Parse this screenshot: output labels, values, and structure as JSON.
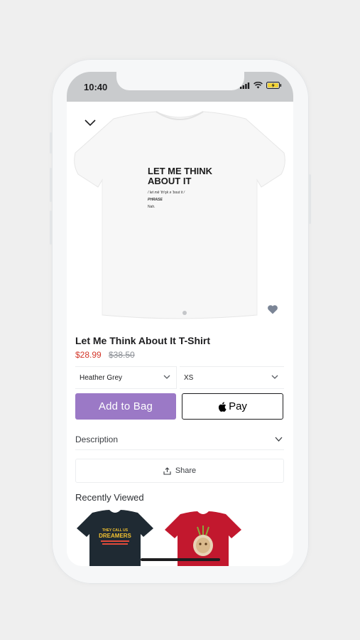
{
  "status": {
    "time": "10:40"
  },
  "product": {
    "title": "Let Me Think About It T-Shirt",
    "price": "$28.99",
    "old_price": "$38.50",
    "shirt_print": {
      "headline_1": "LET ME THINK",
      "headline_2": "ABOUT IT",
      "subtitle": "/ let mē 'th'ŋk ə 'bout it /",
      "tag": "PHRASE",
      "definition": "Nah."
    }
  },
  "options": {
    "color": "Heather Grey",
    "size": "XS"
  },
  "actions": {
    "add_to_bag": "Add to Bag",
    "apple_pay": "Pay",
    "share": "Share"
  },
  "description": {
    "label": "Description"
  },
  "recently_viewed": {
    "title": "Recently Viewed",
    "items": [
      {
        "shirt_color": "#1f2a33",
        "print_line_1": "THEY CALL US",
        "print_line_2": "DREAMERS"
      },
      {
        "shirt_color": "#c2182e"
      }
    ]
  },
  "colors": {
    "accent": "#9b79c6",
    "sale_price": "#d3372a"
  },
  "icons": [
    "chevron-down-icon",
    "heart-icon",
    "apple-icon",
    "share-icon",
    "signal-icon",
    "wifi-icon",
    "battery-icon"
  ]
}
